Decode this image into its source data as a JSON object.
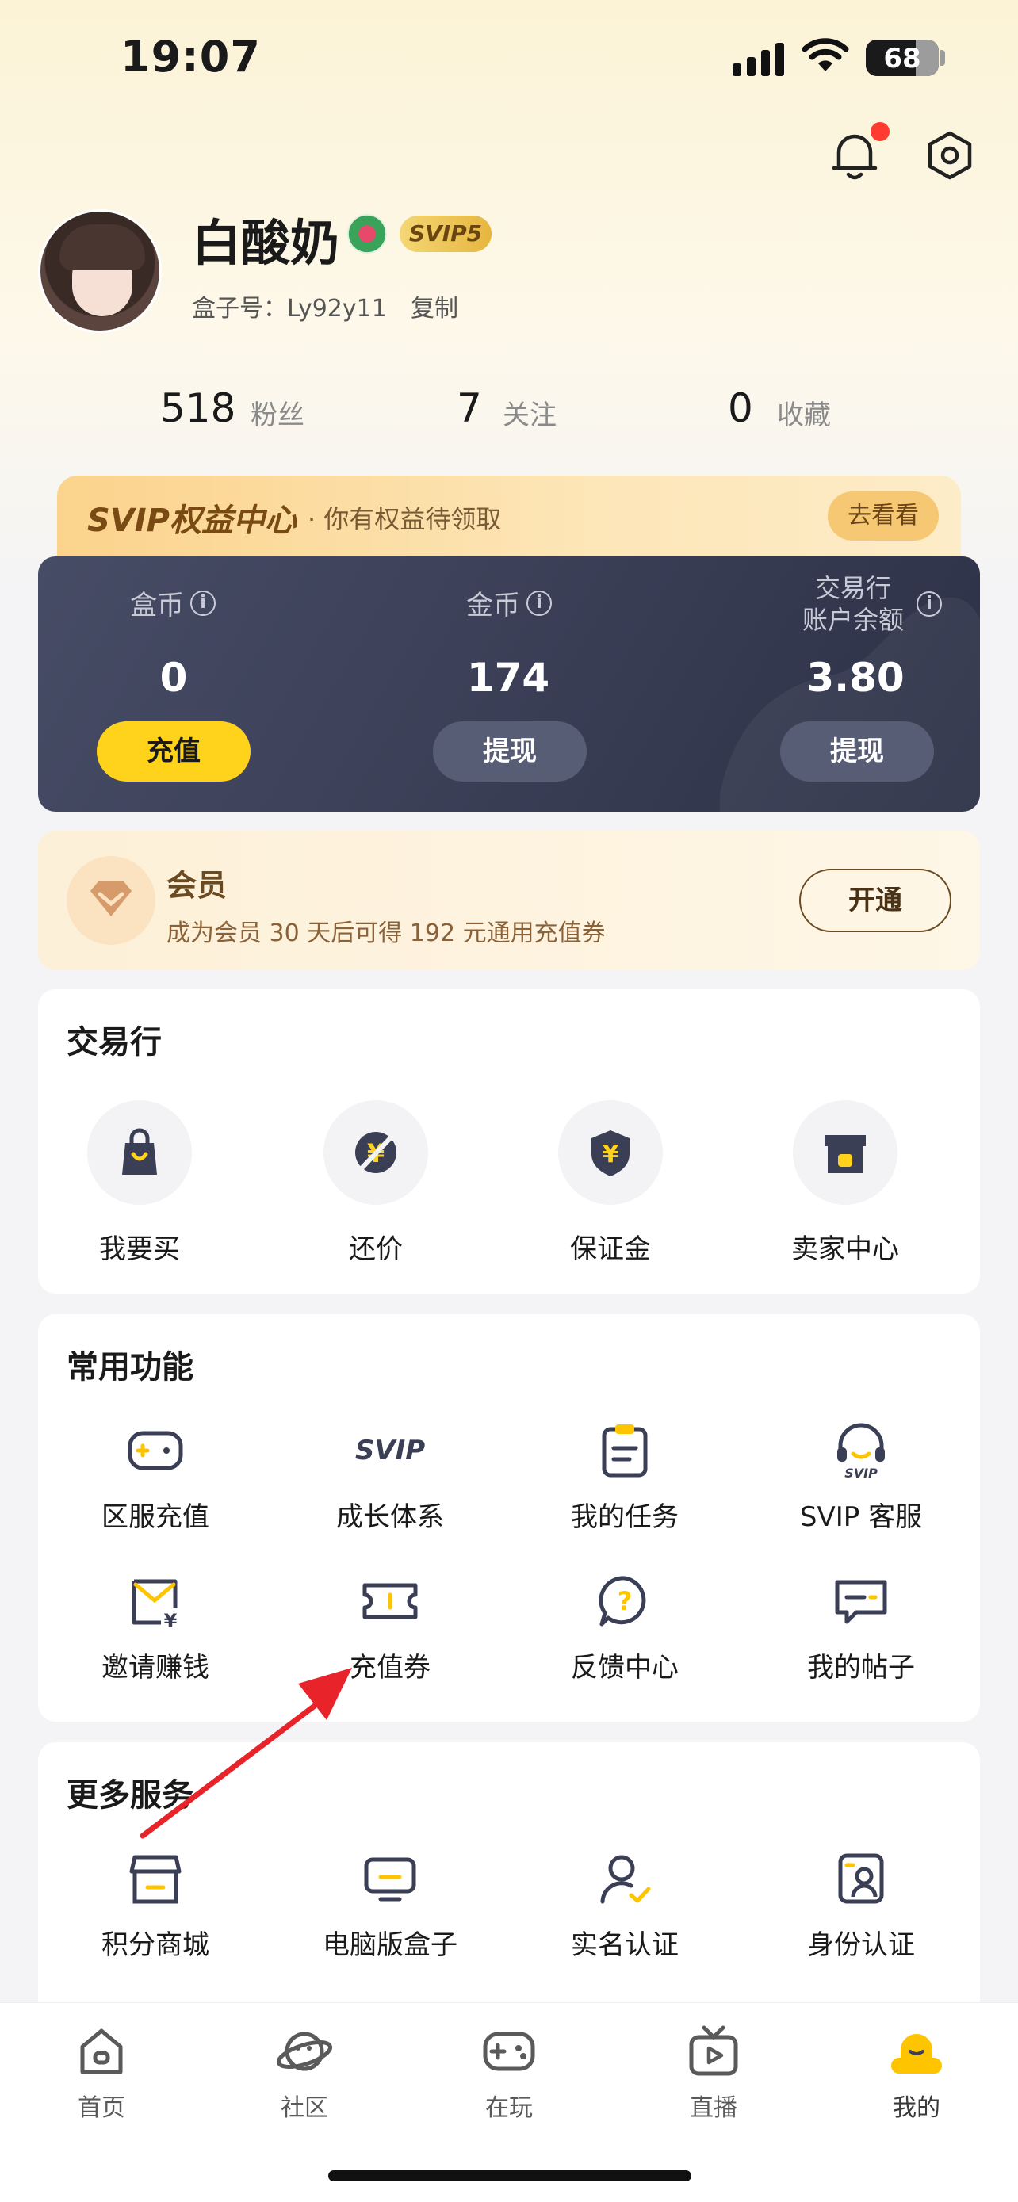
{
  "status_bar": {
    "time": "19:07",
    "battery": "68"
  },
  "profile": {
    "username": "白酸奶",
    "svip_badge": "SVIP5",
    "box_id_label": "盒子号：Ly92y11",
    "copy_label": "复制"
  },
  "stats": [
    {
      "value": "518",
      "label": "粉丝"
    },
    {
      "value": "7",
      "label": "关注"
    },
    {
      "value": "0",
      "label": "收藏"
    }
  ],
  "svip_banner": {
    "logo": "SVIP权益中心",
    "text": "· 你有权益待领取",
    "button": "去看看"
  },
  "wallet": {
    "box_coin": {
      "label": "盒币",
      "value": "0",
      "button": "充值"
    },
    "gold_coin": {
      "label": "金币",
      "value": "174",
      "button": "提现"
    },
    "trade_balance": {
      "label_line1": "交易行",
      "label_line2": "账户余额",
      "value": "3.80",
      "button": "提现"
    }
  },
  "member": {
    "title": "会员",
    "desc": "成为会员 30 天后可得 192 元通用充值券",
    "button": "开通"
  },
  "trade": {
    "title": "交易行",
    "items": [
      {
        "label": "我要买",
        "icon": "shopping-bag-icon"
      },
      {
        "label": "还价",
        "icon": "bargain-icon"
      },
      {
        "label": "保证金",
        "icon": "deposit-shield-icon"
      },
      {
        "label": "卖家中心",
        "icon": "seller-store-icon"
      }
    ]
  },
  "common": {
    "title": "常用功能",
    "items": [
      {
        "label": "区服充值",
        "icon": "gamepad-plus-icon"
      },
      {
        "label": "成长体系",
        "icon": "svip-text-icon",
        "icon_text": "SVIP"
      },
      {
        "label": "我的任务",
        "icon": "clipboard-icon"
      },
      {
        "label": "SVIP 客服",
        "icon": "headset-icon",
        "icon_text": "SVIP"
      },
      {
        "label": "邀请赚钱",
        "icon": "invite-envelope-icon"
      },
      {
        "label": "充值券",
        "icon": "coupon-ticket-icon"
      },
      {
        "label": "反馈中心",
        "icon": "feedback-question-icon"
      },
      {
        "label": "我的帖子",
        "icon": "post-message-icon"
      }
    ]
  },
  "more": {
    "title": "更多服务",
    "items": [
      {
        "label": "积分商城",
        "icon": "points-store-icon"
      },
      {
        "label": "电脑版盒子",
        "icon": "desktop-monitor-icon"
      },
      {
        "label": "实名认证",
        "icon": "user-verified-icon"
      },
      {
        "label": "身份认证",
        "icon": "id-card-icon"
      }
    ]
  },
  "tabbar": [
    {
      "label": "首页",
      "icon": "home-icon"
    },
    {
      "label": "社区",
      "icon": "planet-icon"
    },
    {
      "label": "在玩",
      "icon": "gamepad-icon"
    },
    {
      "label": "直播",
      "icon": "tv-play-icon"
    },
    {
      "label": "我的",
      "icon": "profile-mascot-icon",
      "active": true
    }
  ],
  "colors": {
    "accent_yellow": "#FFD21C",
    "wallet_bg": "#3B3F56",
    "annotation_arrow": "#E8232A"
  }
}
